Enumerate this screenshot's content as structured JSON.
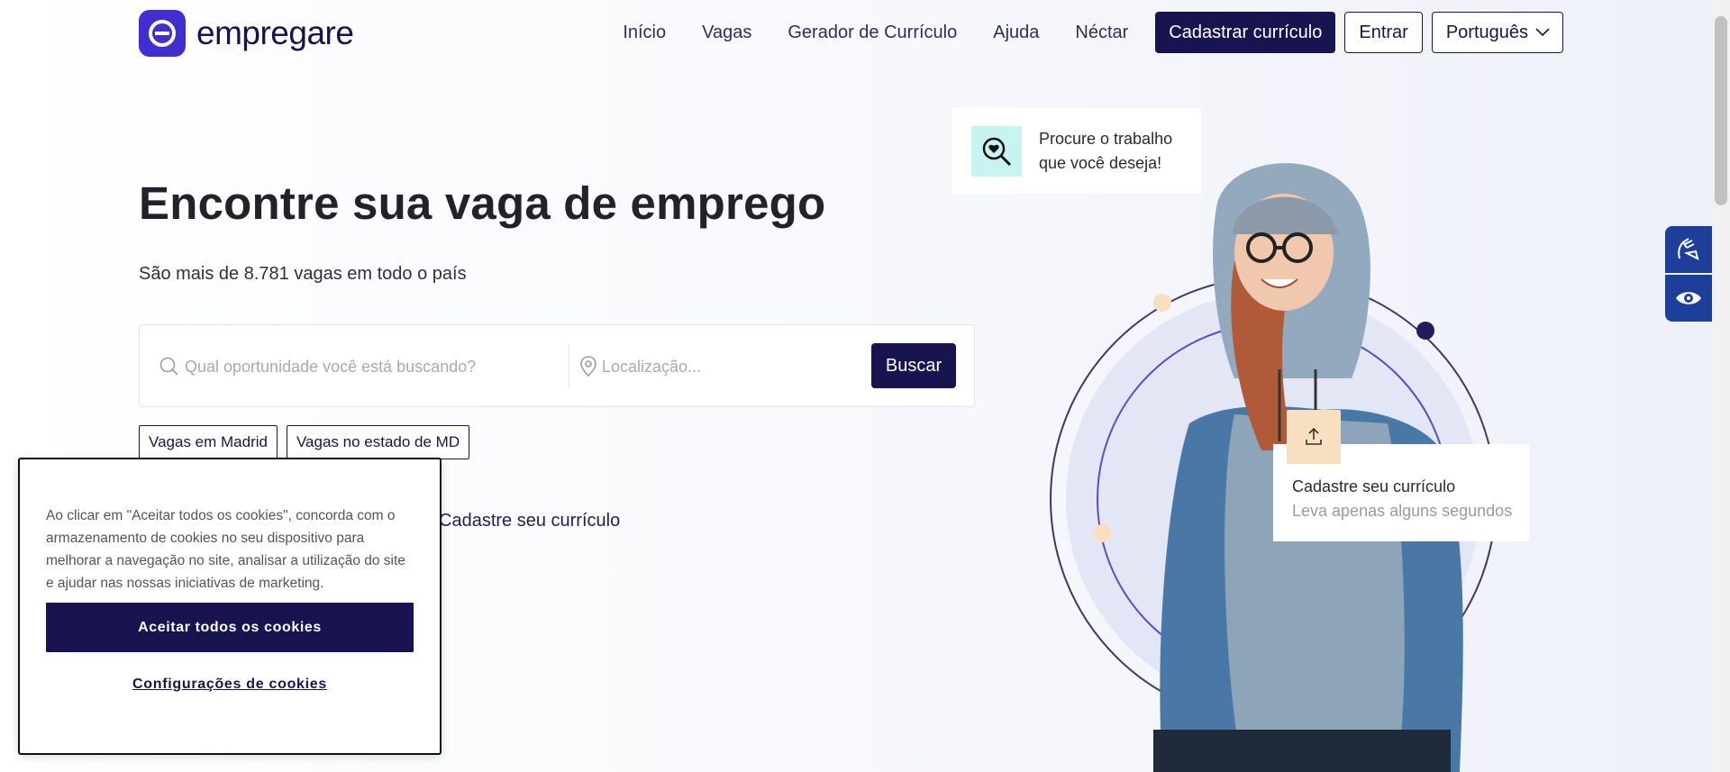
{
  "brand": {
    "name": "empregare",
    "color": "#3f2fd1",
    "dark": "#17144f"
  },
  "nav": {
    "items": [
      "Início",
      "Vagas",
      "Gerador de Currículo",
      "Ajuda",
      "Néctar"
    ],
    "register_label": "Cadastrar currículo",
    "login_label": "Entrar",
    "language_label": "Português"
  },
  "hero": {
    "title": "Encontre sua vaga de emprego",
    "subtitle": "São mais de 8.781 vagas em todo o país",
    "search_placeholder": "Qual oportunidade você está buscando?",
    "location_placeholder": "Localização...",
    "search_button": "Buscar",
    "chips": [
      "Vagas em Madrid",
      "Vagas no estado de MD"
    ],
    "register_link": "Cadastre seu currículo"
  },
  "illustration": {
    "card_top_text": "Procure o trabalho que você deseja!",
    "card_bottom_title": "Cadastre seu currículo",
    "card_bottom_subtitle": "Leva apenas alguns segundos"
  },
  "cookie_banner": {
    "text": "Ao clicar em \"Aceitar todos os cookies\", concorda com o armazenamento de cookies no seu dispositivo para melhorar a navegação no site, analisar a utilização do site e ajudar nas nossas iniciativas de marketing.",
    "accept_label": "Aceitar todos os cookies",
    "settings_label": "Configurações de cookies"
  },
  "icons": [
    "search-heart-icon",
    "search-icon",
    "location-pin-icon",
    "upload-icon",
    "sign-language-icon",
    "eye-icon",
    "chevron-down-icon"
  ]
}
